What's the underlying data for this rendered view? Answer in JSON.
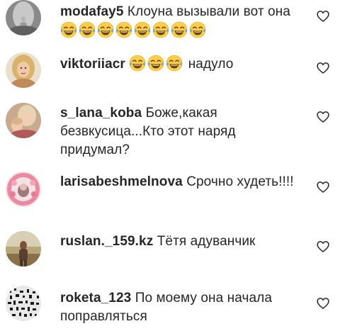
{
  "comments": [
    {
      "username": "modafay5",
      "text": "Клоуна вызывали вот она",
      "emoji": [
        "face-with-tears-of-joy",
        "face-with-tears-of-joy",
        "face-with-tears-of-joy",
        "face-with-tears-of-joy",
        "face-with-tears-of-joy",
        "face-with-tears-of-joy",
        "face-with-tears-of-joy",
        "face-with-tears-of-joy"
      ],
      "avatar_icon": "grayscale-face-photo"
    },
    {
      "username": "viktoriiacr",
      "text": "надуло",
      "emoji": [
        "face-with-tears-of-joy",
        "face-with-tears-of-joy",
        "face-with-tears-of-joy"
      ],
      "avatar_icon": "blonde-woman-photo"
    },
    {
      "username": "s_lana_koba",
      "text": "Боже,какая безвкусица...Кто этот наряд придумал?",
      "avatar_icon": "woman-with-child-photo"
    },
    {
      "username": "larisabeshmelnova",
      "text": "Срочно худеть!!!!",
      "avatar_icon": "pink-heart-wreath-photo"
    },
    {
      "username": "ruslan._159.kz",
      "text": "Тётя адуванчик",
      "avatar_icon": "person-outdoors-photo"
    },
    {
      "username": "roketa_123",
      "text": "По моему она начала поправляться",
      "avatar_icon": "black-white-pattern-photo"
    }
  ],
  "like_icon": "heart-outline-icon",
  "colors": {
    "text": "#262626",
    "background": "#ffffff",
    "emoji_face": "#ffcc4d",
    "emoji_tear": "#5dadec"
  }
}
